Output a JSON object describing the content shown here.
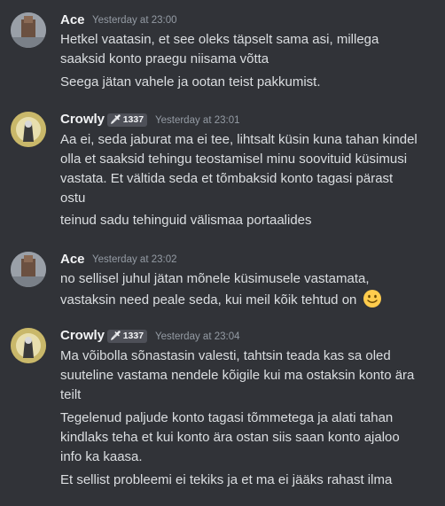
{
  "messages": [
    {
      "author": "Ace",
      "timestamp": "Yesterday at 23:00",
      "lines": [
        "Hetkel vaatasin, et see oleks täpselt sama asi, millega",
        "saaksid konto praegu niisama võtta",
        "Seega jätan vahele ja ootan teist pakkumist."
      ]
    },
    {
      "author": "Crowly",
      "badge": "1337",
      "timestamp": "Yesterday at 23:01",
      "lines": [
        "Aa ei, seda jaburat ma ei tee, lihtsalt küsin kuna tahan kindel",
        "olla et saaksid tehingu teostamisel minu soovituid küsimusi",
        "vastata. Et vältida seda et tõmbaksid konto tagasi pärast",
        "ostu",
        "teinud sadu tehinguid välismaa portaalides"
      ]
    },
    {
      "author": "Ace",
      "timestamp": "Yesterday at 23:02",
      "lines": [
        "no sellisel juhul jätan mõnele küsimusele vastamata,",
        "vastaksin need peale seda, kui meil kõik tehtud on"
      ],
      "emoji": "slightly-smiling-face"
    },
    {
      "author": "Crowly",
      "badge": "1337",
      "timestamp": "Yesterday at 23:04",
      "lines": [
        "Ma võibolla sõnastasin valesti, tahtsin teada kas sa oled",
        "suuteline vastama nendele kõigile kui ma ostaksin konto ära",
        "teilt",
        "Tegelenud paljude konto tagasi tõmmetega ja alati tahan",
        "kindlaks teha et kui konto ära ostan siis saan konto ajaloo",
        "info ka kaasa.",
        "Et sellist probleemi ei tekiks ja et ma ei jääks rahast ilma"
      ]
    }
  ],
  "colors": {
    "background": "#313338",
    "username": "#f2f3f5",
    "text": "#dbdee1",
    "timestamp": "#949ba4",
    "badge_bg": "#4e5058"
  },
  "icons": {
    "badge_icon": "sword-icon",
    "emoji": "slightly-smiling-face"
  }
}
